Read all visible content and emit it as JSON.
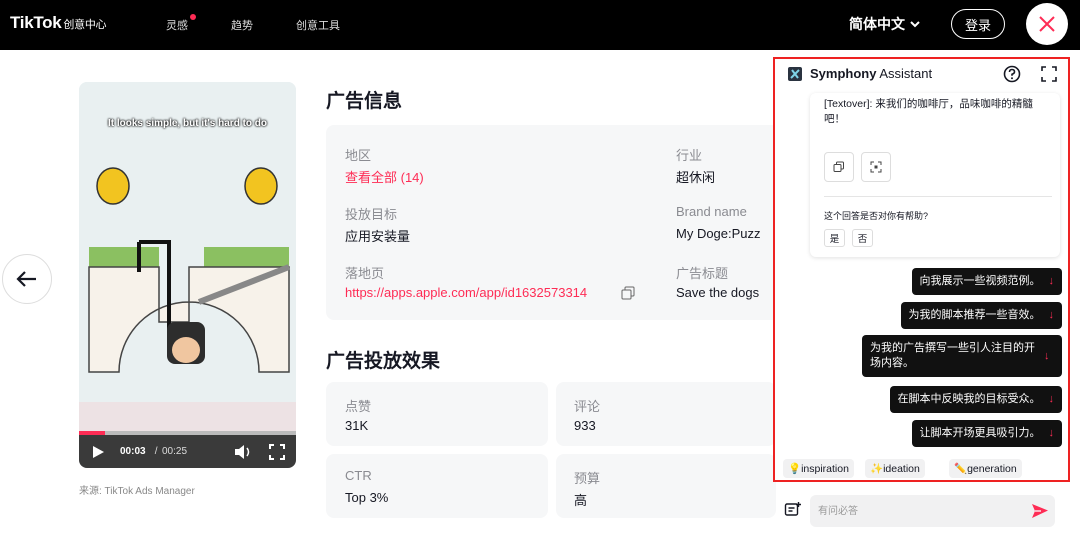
{
  "header": {
    "logo": "TikTok",
    "logo_sub": "创意中心",
    "nav": [
      "灵感",
      "趋势",
      "创意工具"
    ],
    "language": "简体中文",
    "login": "登录"
  },
  "video": {
    "caption": "It looks simple, but it's hard to do",
    "time_current": "00:03",
    "time_sep": " / ",
    "time_total": "00:25",
    "progress": 0.12,
    "source": "来源: TikTok Ads Manager"
  },
  "ad_info": {
    "title": "广告信息",
    "region_label": "地区",
    "region_value": "查看全部 (14)",
    "objective_label": "投放目标",
    "objective_value": "应用安装量",
    "landing_label": "落地页",
    "landing_value": "https://apps.apple.com/app/id1632573314",
    "industry_label": "行业",
    "industry_value": "超休闲",
    "brand_label": "Brand name",
    "brand_value": "My Doge:Puzz",
    "adtitle_label": "广告标题",
    "adtitle_value": "Save the dogs"
  },
  "performance": {
    "title": "广告投放效果",
    "likes_label": "点赞",
    "likes_value": "31K",
    "comments_label": "评论",
    "comments_value": "933",
    "ctr_label": "CTR",
    "ctr_value": "Top 3%",
    "budget_label": "预算",
    "budget_value": "高"
  },
  "assistant": {
    "title_bold": "Symphony",
    "title_rest": " Assistant",
    "bot_message": "[Textover]: 来我们的咖啡厅，品味咖啡的精髓吧！",
    "feedback_question": "这个回答是否对你有帮助?",
    "yes": "是",
    "no": "否",
    "suggestions": [
      "向我展示一些视频范例。",
      "为我的脚本推荐一些音效。",
      "为我的广告撰写一些引人注目的开场内容。",
      "在脚本中反映我的目标受众。",
      "让脚本开场更具吸引力。"
    ],
    "chips": [
      "inspiration",
      "ideation",
      "generation"
    ],
    "input_placeholder": "有问必答"
  },
  "colors": {
    "brand_red": "#fe2c55",
    "panel_border": "#e22222"
  }
}
